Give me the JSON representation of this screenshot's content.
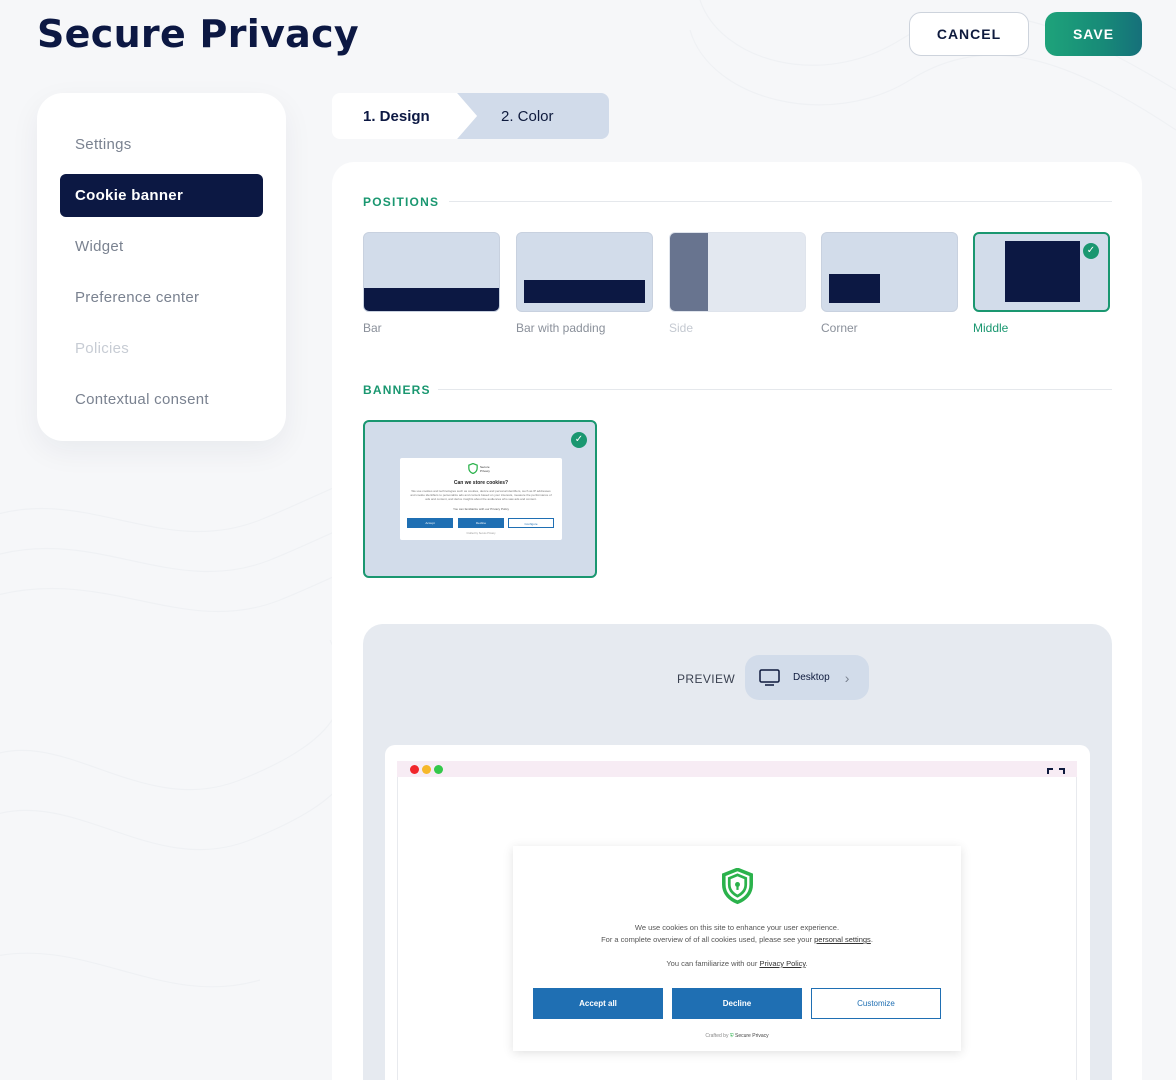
{
  "app": {
    "title": "Secure Privacy"
  },
  "header": {
    "cancel_label": "CANCEL",
    "save_label": "SAVE"
  },
  "sidebar": {
    "items": [
      {
        "label": "Settings",
        "state": "normal"
      },
      {
        "label": "Cookie banner",
        "state": "active"
      },
      {
        "label": "Widget",
        "state": "normal"
      },
      {
        "label": "Preference center",
        "state": "normal"
      },
      {
        "label": "Policies",
        "state": "disabled"
      },
      {
        "label": "Contextual consent",
        "state": "normal"
      }
    ]
  },
  "stepper": {
    "step1": "1. Design",
    "step2": "2. Color"
  },
  "positions": {
    "title": "POSITIONS",
    "options": [
      {
        "label": "Bar",
        "state": "normal"
      },
      {
        "label": "Bar with padding",
        "state": "normal"
      },
      {
        "label": "Side",
        "state": "disabled"
      },
      {
        "label": "Corner",
        "state": "normal"
      },
      {
        "label": "Middle",
        "state": "selected"
      }
    ]
  },
  "banners": {
    "title": "BANNERS",
    "thumbnail": {
      "brand": "Secure Privacy",
      "title": "Can we store cookies?",
      "text": "We use cookies and technologies such as cookies, device and personal identifiers, such as IP addresses and cookie identifiers to personalize ads and content based on your interests, measure the performance of ads and content, and derive insights about the audiences who saw ads and content.",
      "policy_text": "You can familiarize with our Privacy Policy",
      "accept": "Accept",
      "decline": "Decline",
      "configure": "Configure",
      "crafted": "Crafted by Secure Privacy"
    }
  },
  "preview": {
    "label": "PREVIEW",
    "device": "Desktop",
    "modal": {
      "line1": "We use cookies on this site to enhance your user experience.",
      "line2_prefix": "For a complete overview of of all cookies used, please see your ",
      "line2_link": "personal settings",
      "line2_suffix": ".",
      "policy_prefix": "You can familiarize with our ",
      "policy_link": "Privacy Policy",
      "policy_suffix": ".",
      "accept": "Accept all",
      "decline": "Decline",
      "customize": "Customize",
      "crafted_prefix": "Crafted by",
      "crafted_brand": "Secure Privacy"
    }
  },
  "colors": {
    "navy": "#0c1843",
    "accent_green": "#1a9770",
    "button_blue": "#1f6fb3",
    "card_blue": "#d2dcea"
  }
}
